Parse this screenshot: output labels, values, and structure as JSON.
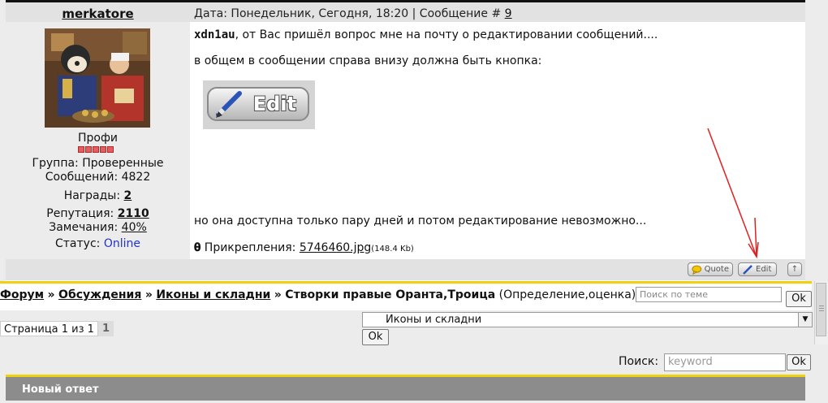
{
  "author": {
    "name": "merkatore",
    "rank_title": "Профи",
    "group_line": "Группа: Проверенные",
    "posts_line": "Сообщений: 4822",
    "awards_label": "Награды:",
    "awards_value": "2",
    "reputation_label": "Репутация:",
    "reputation_value": "2110",
    "warnings_label": "Замечания:",
    "warnings_value": "40%",
    "status_label": "Статус:",
    "status_value": "Online"
  },
  "post": {
    "header_text": "Дата: Понедельник, Сегодня, 18:20 | Сообщение #",
    "post_number": "9",
    "mention": "xdn1au",
    "line1": ", от Вас пришёл вопрос мне на почту о редактировании сообщений....",
    "line2": "в общем в сообщении справа внизу должна быть кнопка:",
    "edit_image_label": "Edit",
    "line3": "но она доступна только пару дней и потом редактирование невозможно...",
    "attach_label": "Прикрепления:",
    "attach_file": "5746460.jpg",
    "attach_size": "(148.4 Kb)"
  },
  "post_footer": {
    "quote_label": "Quote",
    "edit_label": "Edit"
  },
  "nav": {
    "crumbs": [
      "Форум",
      "Обсуждения",
      "Иконы и складни"
    ],
    "separator": "»",
    "topic_title": "Створки правые Оранта,Троица",
    "topic_desc": "(Определение,оценка)",
    "topic_search_placeholder": "Поиск по теме",
    "ok_label": "Ok"
  },
  "pagination": {
    "label": "Страница 1 из 1",
    "current": "1"
  },
  "jump": {
    "selected": "Иконы и складни",
    "ok_label": "Ok"
  },
  "search": {
    "label": "Поиск:",
    "placeholder": "keyword",
    "ok_label": "Ok"
  },
  "reply": {
    "title": "Новый ответ"
  },
  "colors": {
    "accent_yellow": "#f0d20c",
    "pip_red": "#e06060",
    "annotation_arrow": "#e02020",
    "online_blue": "#2233cc"
  }
}
